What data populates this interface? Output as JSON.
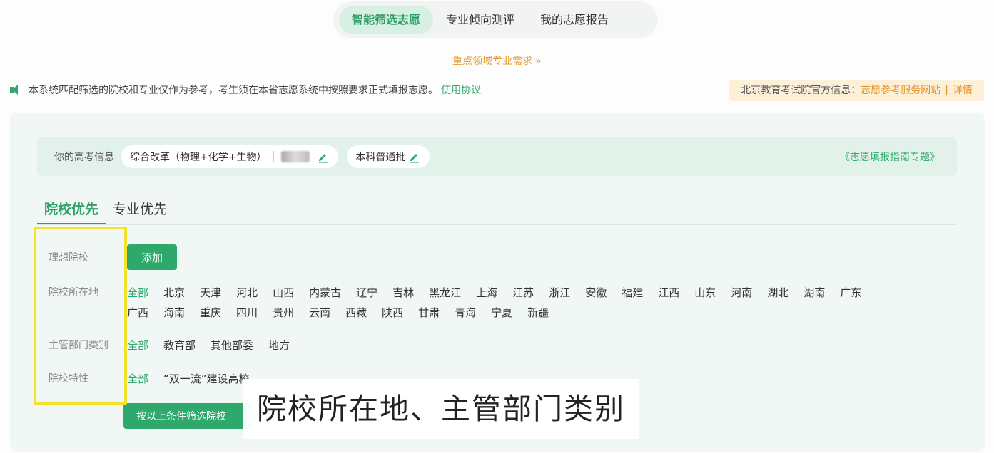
{
  "top_tabs": [
    {
      "label": "智能筛选志愿",
      "active": true
    },
    {
      "label": "专业倾向测评",
      "active": false
    },
    {
      "label": "我的志愿报告",
      "active": false
    }
  ],
  "key_demand": "重点领域专业需求 »",
  "notice": {
    "text": "本系统匹配筛选的院校和专业仅作为参考，考生须在本省志愿系统中按照要求正式填报志愿。",
    "link": "使用协议",
    "icon": "speaker-icon"
  },
  "official": {
    "label": "北京教育考试院官方信息：",
    "site": "志愿参考服务网站",
    "separator": "|",
    "detail": "详情"
  },
  "info_bar": {
    "label": "你的高考信息",
    "subjects": "综合改革（物理+化学+生物）",
    "batch": "本科普通批",
    "guide": "《志愿填报指南专题》"
  },
  "sub_tabs": [
    {
      "label": "院校优先",
      "active": true
    },
    {
      "label": "专业优先",
      "active": false
    }
  ],
  "filters": {
    "ideal": {
      "label": "理想院校",
      "button": "添加"
    },
    "location": {
      "label": "院校所在地",
      "options": [
        "全部",
        "北京",
        "天津",
        "河北",
        "山西",
        "内蒙古",
        "辽宁",
        "吉林",
        "黑龙江",
        "上海",
        "江苏",
        "浙江",
        "安徽",
        "福建",
        "江西",
        "山东",
        "河南",
        "湖北",
        "湖南",
        "广东",
        "广西",
        "海南",
        "重庆",
        "四川",
        "贵州",
        "云南",
        "西藏",
        "陕西",
        "甘肃",
        "青海",
        "宁夏",
        "新疆"
      ]
    },
    "department": {
      "label": "主管部门类别",
      "options": [
        "全部",
        "教育部",
        "其他部委",
        "地方"
      ]
    },
    "feature": {
      "label": "院校特性",
      "options": [
        "全部",
        "“双一流”建设高校"
      ]
    }
  },
  "submit_button": "按以上条件筛选院校",
  "caption": "院校所在地、主管部门类别",
  "colors": {
    "accent": "#2ea86b",
    "orange": "#e4932a",
    "highlight": "#f4e12c"
  }
}
